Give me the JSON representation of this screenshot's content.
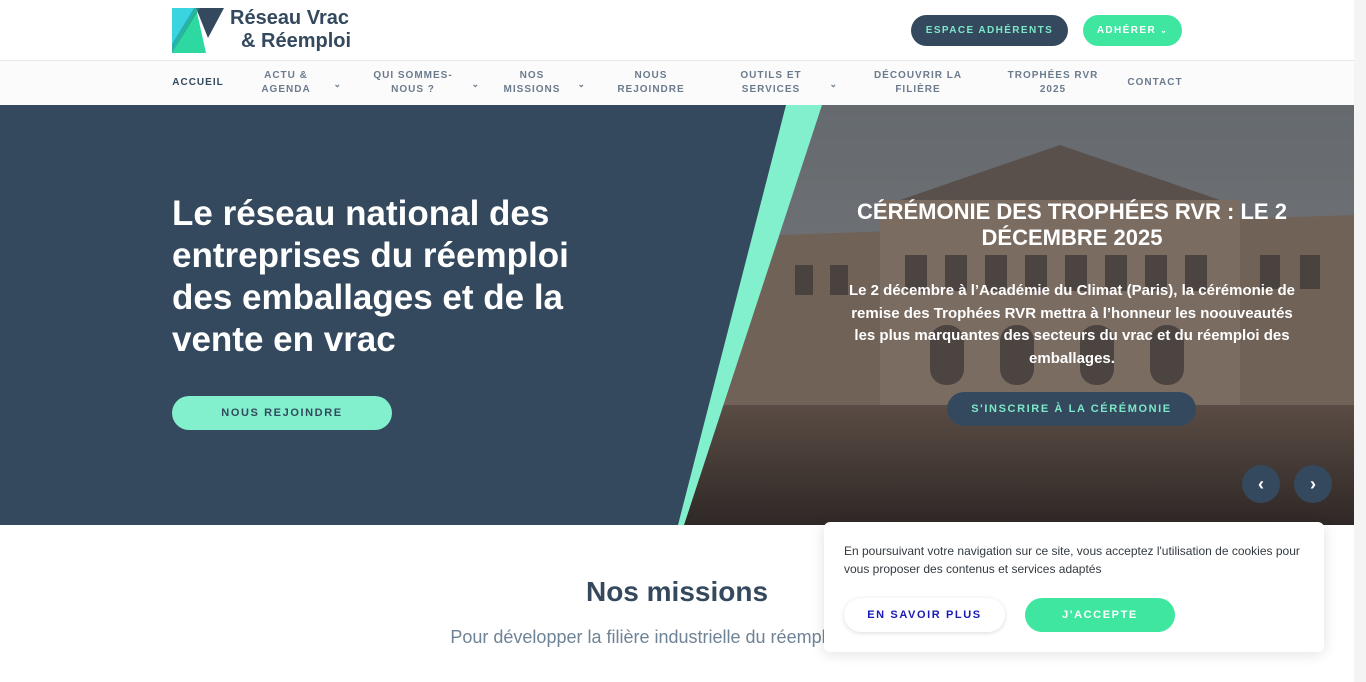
{
  "header": {
    "logo": {
      "line1": "Réseau Vrac",
      "line2": "& Réemploi"
    },
    "espace_adherents": "ESPACE ADHÉRENTS",
    "adherer": "ADHÉRER"
  },
  "nav": {
    "items": [
      {
        "label": "ACCUEIL",
        "active": true,
        "has_dropdown": false
      },
      {
        "label": "ACTU & AGENDA",
        "has_dropdown": true
      },
      {
        "label": "QUI SOMMES-NOUS ?",
        "has_dropdown": true
      },
      {
        "label": "NOS MISSIONS",
        "has_dropdown": true
      },
      {
        "label": "NOUS REJOINDRE",
        "has_dropdown": false
      },
      {
        "label": "OUTILS ET SERVICES",
        "has_dropdown": true
      },
      {
        "label": "DÉCOUVRIR LA FILIÈRE",
        "has_dropdown": false
      },
      {
        "label": "TROPHÉES RVR 2025",
        "has_dropdown": false
      },
      {
        "label": "CONTACT",
        "has_dropdown": false
      }
    ]
  },
  "hero": {
    "title": "Le réseau national des entreprises du réemploi des emballages et de la vente en vrac",
    "cta": "NOUS REJOINDRE",
    "slide": {
      "title": "CÉRÉMONIE DES TROPHÉES RVR : LE 2 DÉCEMBRE 2025",
      "text": "Le 2 décembre à l’Académie du Climat (Paris), la cérémonie de remise des Trophées RVR mettra à l’honneur les noouveautés les plus marquantes des secteurs du vrac et du réemploi des emballages.",
      "cta": "S'INSCRIRE À LA CÉRÉMONIE"
    },
    "prev_icon": "chevron-left-icon",
    "next_icon": "chevron-right-icon"
  },
  "missions": {
    "title": "Nos missions",
    "subtitle": "Pour développer la filière industrielle du réemploi des em"
  },
  "cookie": {
    "text": "En poursuivant votre navigation sur ce site, vous acceptez l'utilisation de cookies pour vous proposer des contenus et services adaptés",
    "learn_more": "EN SAVOIR PLUS",
    "accept": "J'ACCEPTE"
  },
  "colors": {
    "navy": "#34495e",
    "mint": "#82f0cd",
    "green": "#3ee6a0"
  }
}
